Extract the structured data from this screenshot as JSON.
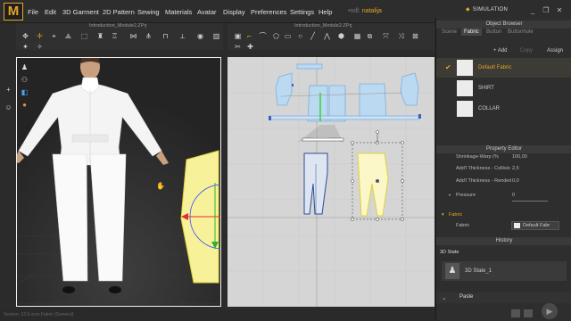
{
  "app": {
    "logo": "M"
  },
  "menu": [
    "File",
    "Edit",
    "3D Garment",
    "2D Pattern",
    "Sewing",
    "Materials",
    "Avatar",
    "Display",
    "Preferences",
    "Settings",
    "Help"
  ],
  "user": {
    "prefix": "•ndl:",
    "name": "natalija"
  },
  "mode_label": "SIMULATION",
  "window_titles": {
    "view3d": "Introduction_Module2.ZPrj",
    "view2d": "Introduction_Module2.ZPrj"
  },
  "object_browser": {
    "title": "Object Browser",
    "tabs": [
      "Scene",
      "Fabric",
      "Button",
      "Buttonhole"
    ],
    "active_tab": "Fabric",
    "buttons": {
      "add": "+ Add",
      "copy": "Copy",
      "assign": "Assign"
    },
    "fabrics": [
      {
        "name": "Default Fabric",
        "selected": true
      },
      {
        "name": "SHIRT",
        "selected": false
      },
      {
        "name": "COLLAR",
        "selected": false
      }
    ]
  },
  "property_editor": {
    "title": "Property Editor",
    "rows": [
      {
        "label": "Shrinkage-Warp (%",
        "value": "100,00"
      },
      {
        "label": "Add'l Thickness - Collisio",
        "value": "2,5"
      },
      {
        "label": "Add'l Thickness - Renderi",
        "value": "0,0"
      },
      {
        "label": "Pressure",
        "value": "0"
      }
    ],
    "section": "Fabric",
    "fabric_label": "Fabric",
    "fabric_value": "Default Fabr"
  },
  "history": {
    "title": "History",
    "item": "3D State",
    "subitem": "3D State_1",
    "last": "Paste"
  },
  "status": "Version: 12.0.xxxx   Fabric (General)"
}
